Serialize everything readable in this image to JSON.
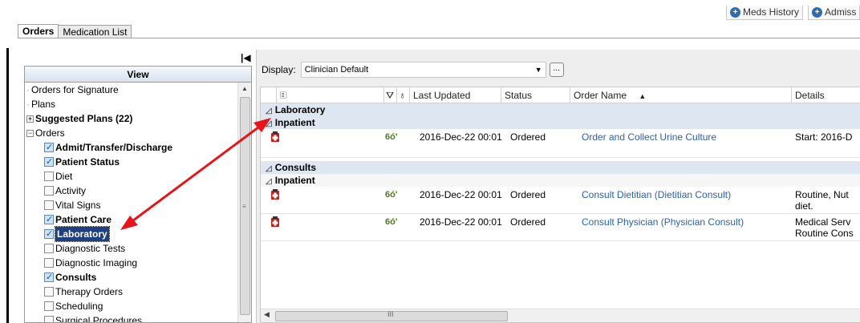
{
  "top_buttons": [
    {
      "label": "Meds History",
      "icon": "plus-circle-icon"
    },
    {
      "label": "Admiss",
      "icon": "plus-circle-icon"
    }
  ],
  "tabs": [
    {
      "label": "Orders",
      "active": true
    },
    {
      "label": "Medication List",
      "active": false
    }
  ],
  "view_panel": {
    "header": "View",
    "items": [
      {
        "label": "Orders for Signature",
        "type": "leaf",
        "bold": false
      },
      {
        "label": "Plans",
        "type": "leaf",
        "bold": false
      },
      {
        "label": "Suggested Plans (22)",
        "type": "expand-plus",
        "bold": true
      },
      {
        "label": "Orders",
        "type": "expand-minus",
        "bold": false
      },
      {
        "label": "Admit/Transfer/Discharge",
        "type": "checkbox",
        "checked": true,
        "bold": true
      },
      {
        "label": "Patient Status",
        "type": "checkbox",
        "checked": true,
        "bold": true
      },
      {
        "label": "Diet",
        "type": "checkbox",
        "checked": false,
        "bold": false
      },
      {
        "label": "Activity",
        "type": "checkbox",
        "checked": false,
        "bold": false
      },
      {
        "label": "Vital Signs",
        "type": "checkbox",
        "checked": false,
        "bold": false
      },
      {
        "label": "Patient Care",
        "type": "checkbox",
        "checked": true,
        "bold": true
      },
      {
        "label": "Laboratory",
        "type": "checkbox",
        "checked": true,
        "bold": true,
        "selected": true
      },
      {
        "label": "Diagnostic Tests",
        "type": "checkbox",
        "checked": false,
        "bold": false
      },
      {
        "label": "Diagnostic Imaging",
        "type": "checkbox",
        "checked": false,
        "bold": false
      },
      {
        "label": "Consults",
        "type": "checkbox",
        "checked": true,
        "bold": true
      },
      {
        "label": "Therapy Orders",
        "type": "checkbox",
        "checked": false,
        "bold": false
      },
      {
        "label": "Scheduling",
        "type": "checkbox",
        "checked": false,
        "bold": false
      },
      {
        "label": "Surgical Procedures",
        "type": "checkbox",
        "checked": false,
        "bold": false
      }
    ]
  },
  "display": {
    "label": "Display:",
    "value": "Clinician Default",
    "more_button": "..."
  },
  "grid": {
    "columns": [
      "",
      "",
      "Last Updated",
      "Status",
      "Order Name",
      "Details"
    ],
    "sections": [
      {
        "title": "Laboratory",
        "subsection": "Inpatient",
        "orders": [
          {
            "last_updated": "2016-Dec-22 00:01",
            "status": "Ordered",
            "order_name": "Order and Collect Urine Culture",
            "details": "Start: 2016-D"
          }
        ]
      },
      {
        "title": "Consults",
        "subsection": "Inpatient",
        "orders": [
          {
            "last_updated": "2016-Dec-22 00:01",
            "status": "Ordered",
            "order_name": "Consult Dietitian (Dietitian Consult)",
            "details": "Routine, Nut",
            "details2": "diet."
          },
          {
            "last_updated": "2016-Dec-22 00:01",
            "status": "Ordered",
            "order_name": "Consult Physician (Physician Consult)",
            "details": "Medical Serv",
            "details2": "Routine Cons"
          }
        ]
      }
    ],
    "sort_indicator": "▲",
    "scroll_grip": "III"
  },
  "annotation_color": "#e8141a",
  "accent_color": "#2a60b8"
}
